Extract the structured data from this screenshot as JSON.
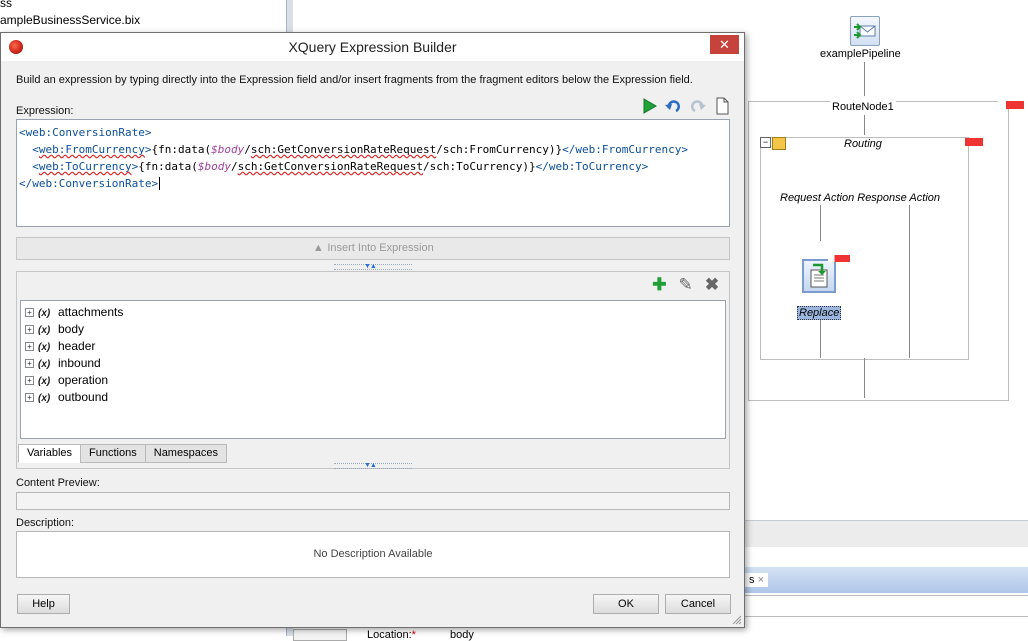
{
  "background": {
    "tree_items": [
      "ss",
      "ampleBusinessService.bix"
    ],
    "diagram": {
      "pipeline_label": "examplePipeline",
      "route_node_label": "RouteNode1",
      "routing_label": "Routing",
      "actions_header": "Request Action Response Action",
      "replace_label": "Replace"
    },
    "bottom": {
      "tab_suffix": "s",
      "location_label": "Location:",
      "location_value": "body"
    }
  },
  "dialog": {
    "title": "XQuery Expression Builder",
    "close_glyph": "✕",
    "instructions": "Build an expression by typing directly into the Expression field and/or insert fragments from the fragment editors below the Expression field.",
    "expression_label": "Expression:",
    "expression_lines": [
      {
        "indent": "",
        "parts": [
          {
            "t": "<web:ConversionRate>",
            "c": "tag"
          }
        ]
      },
      {
        "indent": "  ",
        "parts": [
          {
            "t": "<",
            "c": "tag"
          },
          {
            "t": "web:FromCurrency",
            "c": "tag wavy"
          },
          {
            "t": ">",
            "c": "tag"
          },
          {
            "t": "{fn:data(",
            "c": "fn"
          },
          {
            "t": "$body",
            "c": "var"
          },
          {
            "t": "/",
            "c": "fn"
          },
          {
            "t": "sch:GetConversionRateRequest",
            "c": "fn wavy"
          },
          {
            "t": "/sch:FromCurrency)}",
            "c": "fn"
          },
          {
            "t": "</web:FromCurrency>",
            "c": "tag"
          }
        ]
      },
      {
        "indent": "  ",
        "parts": [
          {
            "t": "<",
            "c": "tag"
          },
          {
            "t": "web:ToCurrency",
            "c": "tag wavy"
          },
          {
            "t": ">",
            "c": "tag"
          },
          {
            "t": "{fn:data(",
            "c": "fn"
          },
          {
            "t": "$body",
            "c": "var"
          },
          {
            "t": "/",
            "c": "fn"
          },
          {
            "t": "sch:GetConversionRateRequest",
            "c": "fn wavy"
          },
          {
            "t": "/sch:ToCurrency)}",
            "c": "fn"
          },
          {
            "t": "</web:ToCurrency>",
            "c": "tag"
          }
        ]
      },
      {
        "indent": "",
        "parts": [
          {
            "t": "</web:ConversionRate>",
            "c": "tag"
          }
        ]
      }
    ],
    "toolbar_icons": [
      "run-icon",
      "undo-icon",
      "redo-icon",
      "new-document-icon"
    ],
    "insert_button": "Insert Into Expression",
    "fragment_icons": [
      "add-icon",
      "edit-icon",
      "delete-icon"
    ],
    "variables": [
      "attachments",
      "body",
      "header",
      "inbound",
      "operation",
      "outbound"
    ],
    "var_icon_text": "(x)",
    "tabs": [
      "Variables",
      "Functions",
      "Namespaces"
    ],
    "active_tab": "Variables",
    "content_preview_label": "Content Preview:",
    "description_label": "Description:",
    "description_text": "No Description Available",
    "help_button": "Help",
    "ok_button": "OK",
    "cancel_button": "Cancel"
  },
  "colors": {
    "close_button": "#c7423a",
    "tag_text": "#0a4f9c",
    "variable_text": "#a13ea1"
  }
}
